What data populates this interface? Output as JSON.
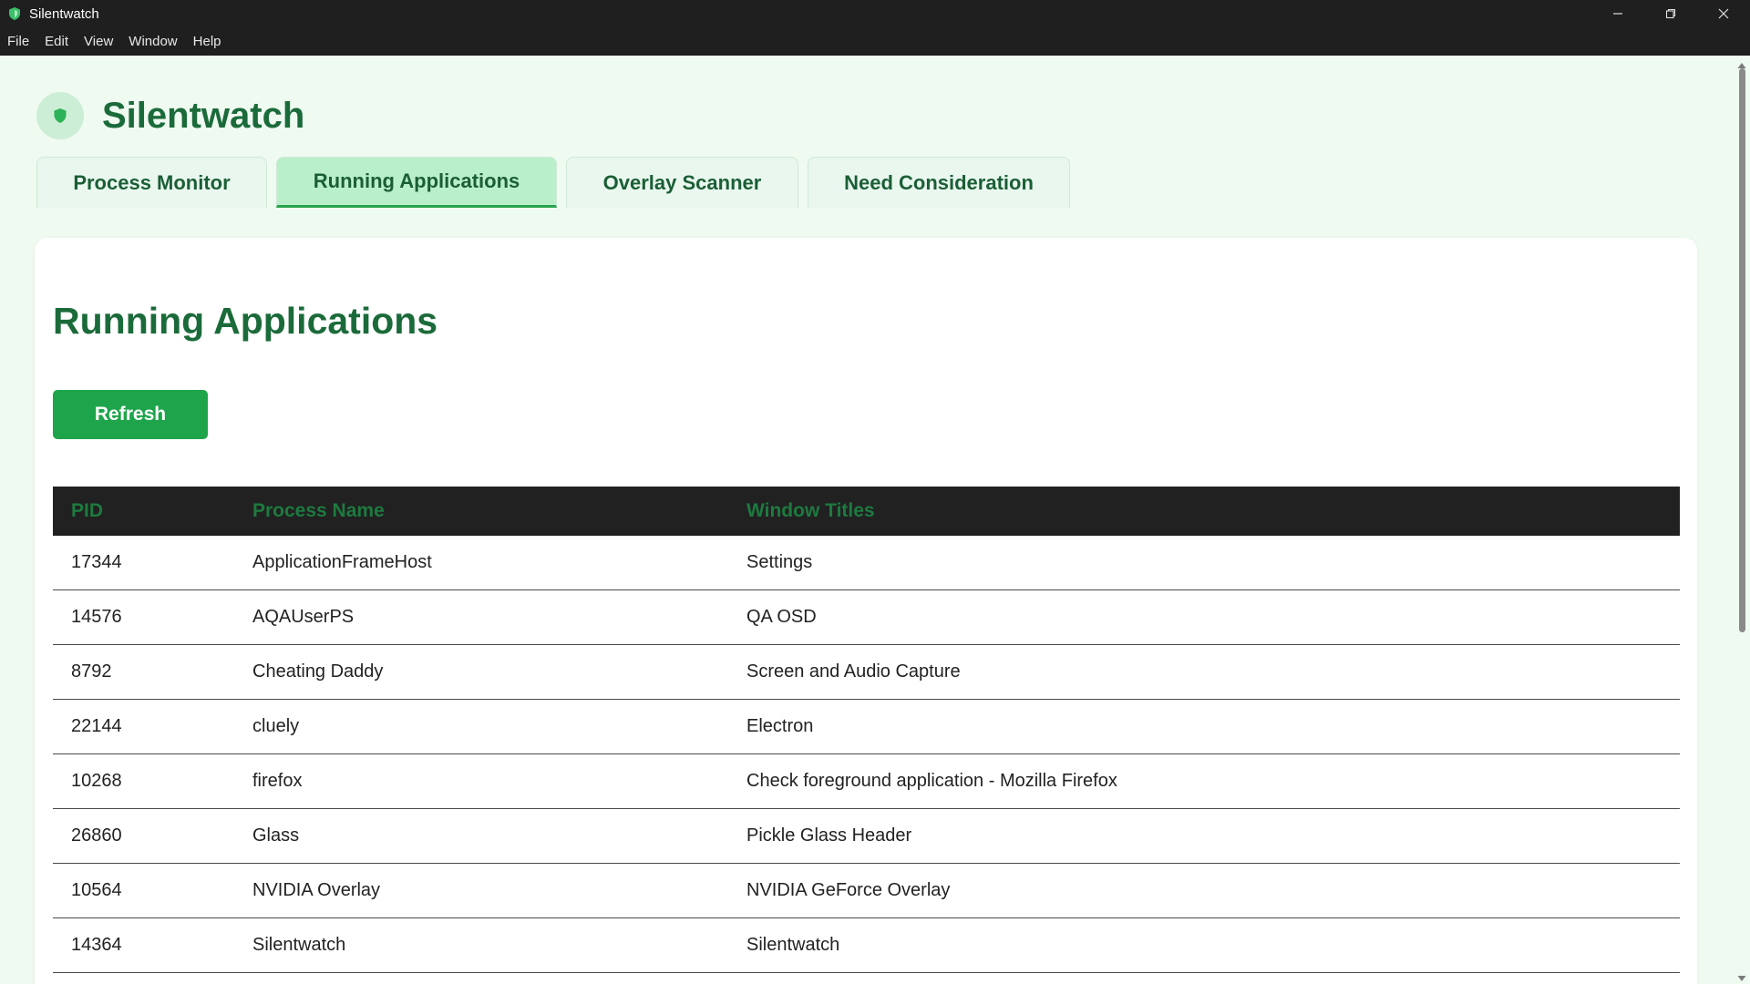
{
  "window": {
    "title": "Silentwatch",
    "icon": "shield-icon",
    "controls": [
      "minimize-icon",
      "restore-icon",
      "close-icon"
    ]
  },
  "menu": [
    "File",
    "Edit",
    "View",
    "Window",
    "Help"
  ],
  "header": {
    "app_name": "Silentwatch",
    "logo": "shield-icon"
  },
  "tabs": [
    {
      "label": "Process Monitor",
      "active": false
    },
    {
      "label": "Running Applications",
      "active": true
    },
    {
      "label": "Overlay Scanner",
      "active": false
    },
    {
      "label": "Need Consideration",
      "active": false
    }
  ],
  "main": {
    "title": "Running Applications",
    "refresh_label": "Refresh",
    "columns": [
      "PID",
      "Process Name",
      "Window Titles"
    ],
    "rows": [
      {
        "pid": "17344",
        "name": "ApplicationFrameHost",
        "title": "Settings"
      },
      {
        "pid": "14576",
        "name": "AQAUserPS",
        "title": "QA OSD"
      },
      {
        "pid": "8792",
        "name": "Cheating Daddy",
        "title": "Screen and Audio Capture"
      },
      {
        "pid": "22144",
        "name": "cluely",
        "title": "Electron"
      },
      {
        "pid": "10268",
        "name": "firefox",
        "title": "Check foreground application - Mozilla Firefox"
      },
      {
        "pid": "26860",
        "name": "Glass",
        "title": "Pickle Glass Header"
      },
      {
        "pid": "10564",
        "name": "NVIDIA Overlay",
        "title": "NVIDIA GeForce Overlay"
      },
      {
        "pid": "14364",
        "name": "Silentwatch",
        "title": "Silentwatch"
      }
    ]
  },
  "colors": {
    "accent": "#1ea54b",
    "brand_text": "#1b6b3a",
    "active_tab": "#b9f0cb",
    "table_header_bg": "#212121",
    "table_header_text": "#1d7a3f"
  }
}
